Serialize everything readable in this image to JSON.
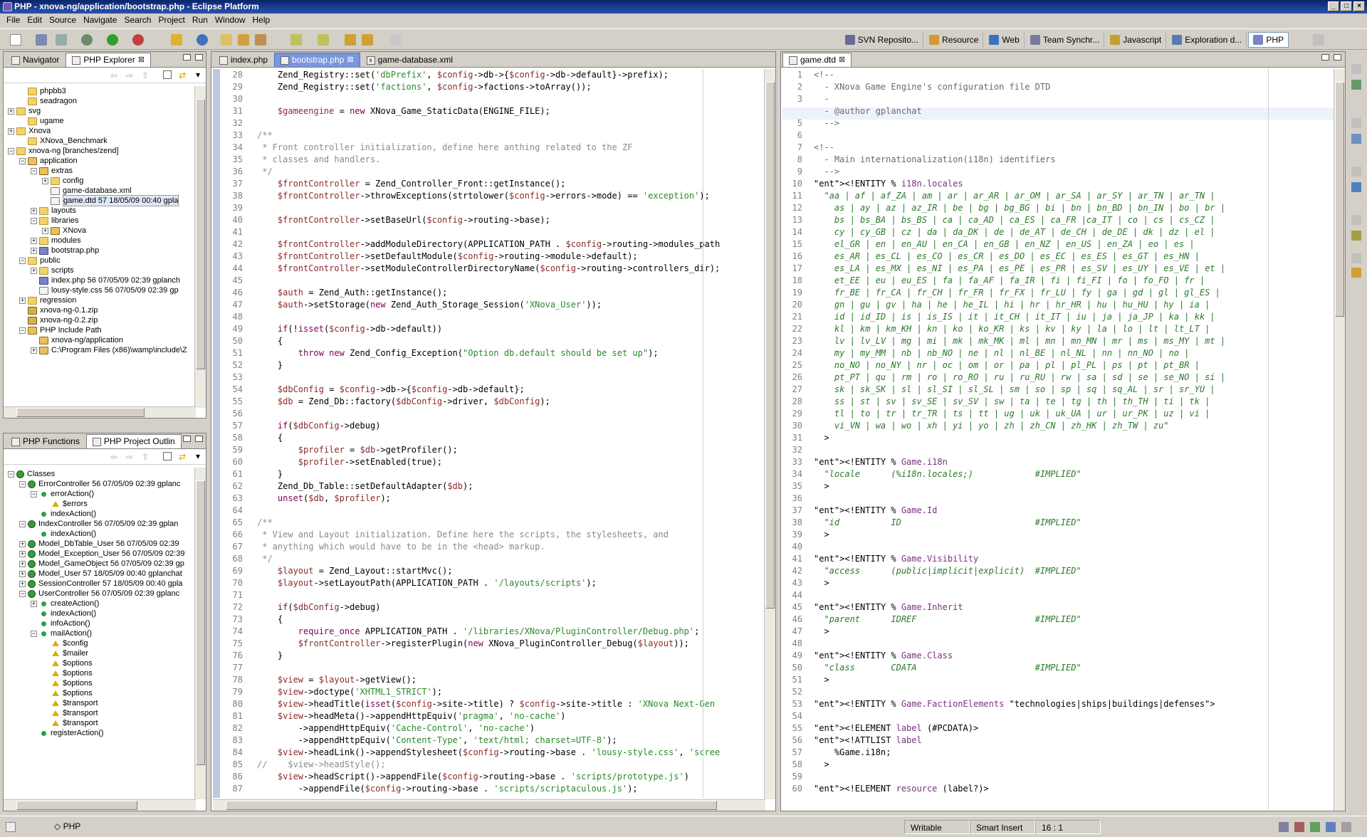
{
  "window": {
    "title": "PHP - xnova-ng/application/bootstrap.php - Eclipse Platform"
  },
  "menu": [
    "File",
    "Edit",
    "Source",
    "Navigate",
    "Search",
    "Project",
    "Run",
    "Window",
    "Help"
  ],
  "perspectives": [
    "SVN Reposito...",
    "Resource",
    "Web",
    "Team Synchr...",
    "Javascript",
    "Exploration d...",
    "PHP"
  ],
  "left_top": {
    "tabs": [
      "Navigator",
      "PHP Explorer"
    ],
    "tree": [
      {
        "d": 1,
        "e": "",
        "i": "folder",
        "t": "phpbb3"
      },
      {
        "d": 1,
        "e": "",
        "i": "folder",
        "t": "seadragon"
      },
      {
        "d": 0,
        "e": "+",
        "i": "folder",
        "t": "svg"
      },
      {
        "d": 1,
        "e": "",
        "i": "folder",
        "t": "ugame"
      },
      {
        "d": 0,
        "e": "+",
        "i": "folder",
        "t": "Xnova"
      },
      {
        "d": 1,
        "e": "",
        "i": "folder",
        "t": "XNova_Benchmark"
      },
      {
        "d": 0,
        "e": "-",
        "i": "folder",
        "t": "xnova-ng [branches/zend]"
      },
      {
        "d": 1,
        "e": "-",
        "i": "pkg",
        "t": "application"
      },
      {
        "d": 2,
        "e": "-",
        "i": "pkg",
        "t": "extras"
      },
      {
        "d": 3,
        "e": "+",
        "i": "folder",
        "t": "config"
      },
      {
        "d": 3,
        "e": "",
        "i": "file",
        "t": "game-database.xml"
      },
      {
        "d": 3,
        "e": "",
        "i": "file",
        "t": "game.dtd 57  18/05/09 00:40  gpla",
        "sel": true
      },
      {
        "d": 2,
        "e": "+",
        "i": "folder",
        "t": "layouts"
      },
      {
        "d": 2,
        "e": "-",
        "i": "folder",
        "t": "libraries"
      },
      {
        "d": 3,
        "e": "+",
        "i": "pkg",
        "t": "XNova"
      },
      {
        "d": 2,
        "e": "+",
        "i": "folder",
        "t": "modules"
      },
      {
        "d": 2,
        "e": "+",
        "i": "php",
        "t": "bootstrap.php"
      },
      {
        "d": 1,
        "e": "-",
        "i": "folder",
        "t": "public"
      },
      {
        "d": 2,
        "e": "+",
        "i": "folder",
        "t": "scripts"
      },
      {
        "d": 2,
        "e": "",
        "i": "php",
        "t": "index.php 56  07/05/09 02:39  gplanch"
      },
      {
        "d": 2,
        "e": "",
        "i": "file",
        "t": "lousy-style.css 56  07/05/09 02:39  gp"
      },
      {
        "d": 1,
        "e": "+",
        "i": "folder",
        "t": "regression"
      },
      {
        "d": 1,
        "e": "",
        "i": "zip",
        "t": "xnova-ng-0.1.zip"
      },
      {
        "d": 1,
        "e": "",
        "i": "zip",
        "t": "xnova-ng-0.2.zip"
      },
      {
        "d": 1,
        "e": "-",
        "i": "pkg",
        "t": "PHP Include Path"
      },
      {
        "d": 2,
        "e": "",
        "i": "pkg",
        "t": "xnova-ng/application"
      },
      {
        "d": 2,
        "e": "+",
        "i": "pkg",
        "t": "C:\\Program Files (x86)\\wamp\\include\\Z"
      }
    ]
  },
  "left_bottom": {
    "tabs": [
      "PHP Functions",
      "PHP Project Outlin"
    ],
    "tree": [
      {
        "d": 0,
        "e": "-",
        "i": "cls",
        "t": "Classes"
      },
      {
        "d": 1,
        "e": "-",
        "i": "cls",
        "t": "ErrorController 56  07/05/09 02:39  gplanc"
      },
      {
        "d": 2,
        "e": "-",
        "i": "meth",
        "t": "errorAction()"
      },
      {
        "d": 3,
        "e": "",
        "i": "var",
        "t": "$errors"
      },
      {
        "d": 2,
        "e": "",
        "i": "meth",
        "t": "indexAction()"
      },
      {
        "d": 1,
        "e": "-",
        "i": "cls",
        "t": "IndexController 56  07/05/09 02:39  gplan"
      },
      {
        "d": 2,
        "e": "",
        "i": "meth",
        "t": "indexAction()"
      },
      {
        "d": 1,
        "e": "+",
        "i": "cls",
        "t": "Model_DbTable_User 56  07/05/09 02:39"
      },
      {
        "d": 1,
        "e": "+",
        "i": "cls",
        "t": "Model_Exception_User 56  07/05/09 02:39"
      },
      {
        "d": 1,
        "e": "+",
        "i": "cls",
        "t": "Model_GameObject 56  07/05/09 02:39  gp"
      },
      {
        "d": 1,
        "e": "+",
        "i": "cls",
        "t": "Model_User 57  18/05/09 00:40  gplanchat"
      },
      {
        "d": 1,
        "e": "+",
        "i": "cls",
        "t": "SessionController 57  18/05/09 00:40  gpla"
      },
      {
        "d": 1,
        "e": "-",
        "i": "cls",
        "t": "UserController 56  07/05/09 02:39  gplanc"
      },
      {
        "d": 2,
        "e": "+",
        "i": "meth",
        "t": "createAction()"
      },
      {
        "d": 2,
        "e": "",
        "i": "meth",
        "t": "indexAction()"
      },
      {
        "d": 2,
        "e": "",
        "i": "meth",
        "t": "infoAction()"
      },
      {
        "d": 2,
        "e": "-",
        "i": "meth",
        "t": "mailAction()"
      },
      {
        "d": 3,
        "e": "",
        "i": "var",
        "t": "$config"
      },
      {
        "d": 3,
        "e": "",
        "i": "var",
        "t": "$mailer"
      },
      {
        "d": 3,
        "e": "",
        "i": "var",
        "t": "$options"
      },
      {
        "d": 3,
        "e": "",
        "i": "var",
        "t": "$options"
      },
      {
        "d": 3,
        "e": "",
        "i": "var",
        "t": "$options"
      },
      {
        "d": 3,
        "e": "",
        "i": "var",
        "t": "$options"
      },
      {
        "d": 3,
        "e": "",
        "i": "var",
        "t": "$transport"
      },
      {
        "d": 3,
        "e": "",
        "i": "var",
        "t": "$transport"
      },
      {
        "d": 3,
        "e": "",
        "i": "var",
        "t": "$transport"
      },
      {
        "d": 2,
        "e": "",
        "i": "meth",
        "t": "registerAction()"
      }
    ]
  },
  "editor_tabs": [
    "index.php",
    "bootstrap.php",
    "game-database.xml"
  ],
  "php_start": 28,
  "php_code": [
    "    Zend_Registry::set('dbPrefix', $config->db->{$config->db->default}->prefix);",
    "    Zend_Registry::set('factions', $config->factions->toArray());",
    "",
    "    $gameengine = new XNova_Game_StaticData(ENGINE_FILE);",
    "",
    "/**",
    " * Front controller initialization, define here anthing related to the ZF",
    " * classes and handlers.",
    " */",
    "    $frontController = Zend_Controller_Front::getInstance();",
    "    $frontController->throwExceptions(strtolower($config->errors->mode) == 'exception');",
    "",
    "    $frontController->setBaseUrl($config->routing->base);",
    "",
    "    $frontController->addModuleDirectory(APPLICATION_PATH . $config->routing->modules_path",
    "    $frontController->setDefaultModule($config->routing->module->default);",
    "    $frontController->setModuleControllerDirectoryName($config->routing->controllers_dir);",
    "",
    "    $auth = Zend_Auth::getInstance();",
    "    $auth->setStorage(new Zend_Auth_Storage_Session('XNova_User'));",
    "",
    "    if(!isset($config->db->default))",
    "    {",
    "        throw new Zend_Config_Exception(\"Option db.default should be set up\");",
    "    }",
    "",
    "    $dbConfig = $config->db->{$config->db->default};",
    "    $db = Zend_Db::factory($dbConfig->driver, $dbConfig);",
    "",
    "    if($dbConfig->debug)",
    "    {",
    "        $profiler = $db->getProfiler();",
    "        $profiler->setEnabled(true);",
    "    }",
    "    Zend_Db_Table::setDefaultAdapter($db);",
    "    unset($db, $profiler);",
    "",
    "/**",
    " * View and Layout initialization. Define here the scripts, the stylesheets, and",
    " * anything which would have to be in the <head> markup.",
    " */",
    "    $layout = Zend_Layout::startMvc();",
    "    $layout->setLayoutPath(APPLICATION_PATH . '/layouts/scripts');",
    "",
    "    if($dbConfig->debug)",
    "    {",
    "        require_once APPLICATION_PATH . '/libraries/XNova/PluginController/Debug.php';",
    "        $frontController->registerPlugin(new XNova_PluginController_Debug($layout));",
    "    }",
    "",
    "    $view = $layout->getView();",
    "    $view->doctype('XHTML1_STRICT');",
    "    $view->headTitle(isset($config->site->title) ? $config->site->title : 'XNova Next-Gen",
    "    $view->headMeta()->appendHttpEquiv('pragma', 'no-cache')",
    "        ->appendHttpEquiv('Cache-Control', 'no-cache')",
    "        ->appendHttpEquiv('Content-Type', 'text/html; charset=UTF-8');",
    "    $view->headLink()->appendStylesheet($config->routing->base . 'lousy-style.css', 'scree",
    "//    $view->headStyle();",
    "    $view->headScript()->appendFile($config->routing->base . 'scripts/prototype.js')",
    "        ->appendFile($config->routing->base . 'scripts/scriptaculous.js');"
  ],
  "dtd_tab": "game.dtd",
  "dtd_start": 1,
  "dtd_code": [
    "<!--",
    "  - XNova Game Engine's configuration file DTD",
    "  -",
    "  - @author gplanchat",
    "  -->",
    "",
    "<!--",
    "  - Main internationalization(i18n) identifiers",
    "  -->",
    "<!ENTITY % i18n.locales",
    "  \"aa | af | af_ZA | am | ar | ar_AR | ar_OM | ar_SA | ar_SY | ar_TN | ar_TN |",
    "    as | ay | az | az_IR | be | bg | bg_BG | bi | bn | bn_BD | bn_IN | bo | br |",
    "    bs | bs_BA | bs_BS | ca | ca_AD | ca_ES | ca_FR |ca_IT | co | cs | cs_CZ |",
    "    cy | cy_GB | cz | da | da_DK | de | de_AT | de_CH | de_DE | dk | dz | el |",
    "    el_GR | en | en_AU | en_CA | en_GB | en_NZ | en_US | en_ZA | eo | es |",
    "    es_AR | es_CL | es_CO | es_CR | es_DO | es_EC | es_ES | es_GT | es_HN |",
    "    es_LA | es_MX | es_NI | es_PA | es_PE | es_PR | es_SV | es_UY | es_VE | et |",
    "    et_EE | eu | eu_ES | fa | fa_AF | fa_IR | fi | fi_FI | fo | fo_FO | fr |",
    "    fr_BE | fr_CA | fr_CH | fr_FR | fr_FX | fr_LU | fy | ga | gd | gl | gl_ES |",
    "    gn | gu | gv | ha | he | he_IL | hi | hr | hr_HR | hu | hu_HU | hy | ia |",
    "    id | id_ID | is | is_IS | it | it_CH | it_IT | iu | ja | ja_JP | ka | kk |",
    "    kl | km | km_KH | kn | ko | ko_KR | ks | kv | ky | la | lo | lt | lt_LT |",
    "    lv | lv_LV | mg | mi | mk | mk_MK | ml | mn | mn_MN | mr | ms | ms_MY | mt |",
    "    my | my_MM | nb | nb_NO | ne | nl | nl_BE | nl_NL | nn | nn_NO | no |",
    "    no_NO | no_NY | nr | oc | om | or | pa | pl | pl_PL | ps | pt | pt_BR |",
    "    pt_PT | qu | rm | ro | ro_RO | ru | ru_RU | rw | sa | sd | se | se_NO | si |",
    "    sk | sk_SK | sl | sl_SI | sl_SL | sm | so | sp | sq | sq_AL | sr | sr_YU |",
    "    ss | st | sv | sv_SE | sv_SV | sw | ta | te | tg | th | th_TH | ti | tk |",
    "    tl | to | tr | tr_TR | ts | tt | ug | uk | uk_UA | ur | ur_PK | uz | vi |",
    "    vi_VN | wa | wo | xh | yi | yo | zh | zh_CN | zh_HK | zh_TW | zu\"",
    "  >",
    "",
    "<!ENTITY % Game.i18n",
    "  \"locale      (%i18n.locales;)            #IMPLIED\"",
    "  >",
    "",
    "<!ENTITY % Game.Id",
    "  \"id          ID                          #IMPLIED\"",
    "  >",
    "",
    "<!ENTITY % Game.Visibility",
    "  \"access      (public|implicit|explicit)  #IMPLIED\"",
    "  >",
    "",
    "<!ENTITY % Game.Inherit",
    "  \"parent      IDREF                       #IMPLIED\"",
    "  >",
    "",
    "<!ENTITY % Game.Class",
    "  \"class       CDATA                       #IMPLIED\"",
    "  >",
    "",
    "<!ENTITY % Game.FactionElements \"technologies|ships|buildings|defenses\">",
    "",
    "<!ELEMENT label (#PCDATA)>",
    "<!ATTLIST label",
    "    %Game.i18n;",
    "  >",
    "",
    "<!ELEMENT resource (label?)>"
  ],
  "status": {
    "perspective": "PHP",
    "mode": "Writable",
    "insert": "Smart Insert",
    "pos": "16 : 1"
  },
  "colors": {
    "title_bar": "#0a246a",
    "keyword": "#7f0055",
    "variable": "#8a2b2b",
    "string": "#2a8a2a",
    "comment": "#8a8a8a",
    "dtd_entity": "#2040c0"
  }
}
